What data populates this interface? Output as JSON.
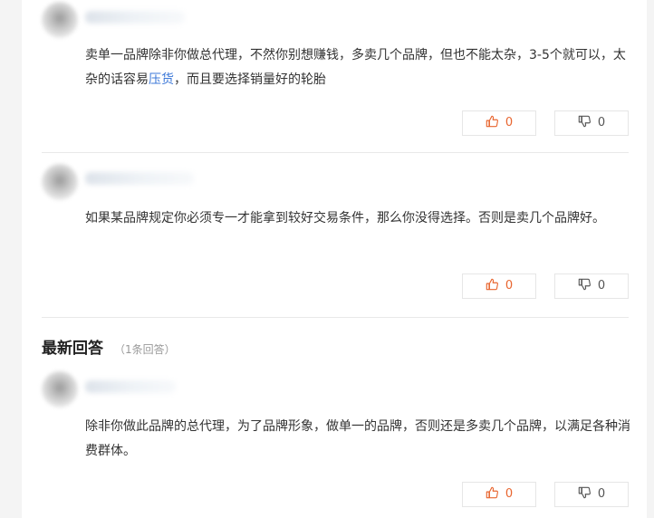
{
  "answers_top": [
    {
      "text_before_link": "卖单一品牌除非你做总代理，不然你别想赚钱，多卖几个品牌，但也不能太杂，3-5个就可以，太杂的话容易",
      "link_text": "压货",
      "text_after_link": "，而且要选择销量好的轮胎",
      "up_count": "0",
      "down_count": "0"
    },
    {
      "text": "如果某品牌规定你必须专一才能拿到较好交易条件，那么你没得选择。否则是卖几个品牌好。",
      "up_count": "0",
      "down_count": "0"
    }
  ],
  "latest_section": {
    "title": "最新回答",
    "count": "（1条回答）"
  },
  "latest_answer": {
    "text": "除非你做此品牌的总代理，为了品牌形象，做单一的品牌，否则还是多卖几个品牌，以满足各种消费群体。",
    "up_count": "0",
    "down_count": "0"
  },
  "icons": {
    "like": "thumbs-up-icon",
    "dislike": "thumbs-down-icon"
  },
  "colors": {
    "like": "#e8652f",
    "link": "#3c78d8"
  }
}
